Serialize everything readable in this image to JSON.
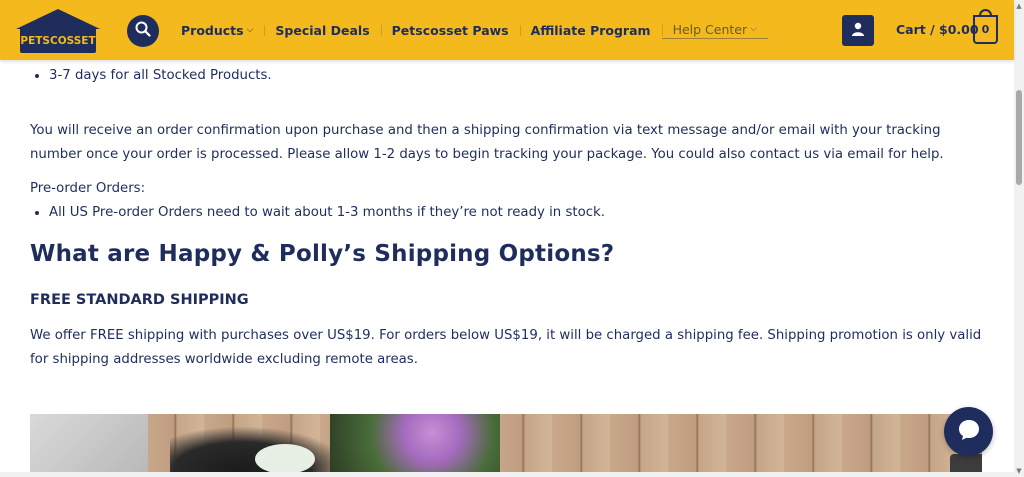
{
  "header": {
    "logo_text": "PETSCOSSET",
    "nav": [
      {
        "label": "Products",
        "has_dropdown": true
      },
      {
        "label": "Special Deals",
        "has_dropdown": false
      },
      {
        "label": "Petscosset Paws",
        "has_dropdown": false
      },
      {
        "label": "Affiliate Program",
        "has_dropdown": false
      },
      {
        "label": "Help Center",
        "has_dropdown": true
      }
    ],
    "cart_label": "Cart / $0.00",
    "cart_count": "0",
    "icons": {
      "search": "search-icon",
      "account": "user-icon",
      "chat": "chat-icon"
    }
  },
  "content": {
    "stocked_bullet": "3-7 days for all Stocked Products.",
    "confirmation_text": "You will receive an order confirmation upon purchase and then a shipping confirmation via text message and/or email with your tracking number once your order is processed. Please allow 1-2 days to begin tracking your package. You could also contact us via email for help.",
    "preorder_heading": "Pre-order Orders:",
    "preorder_bullet": "All US Pre-order Orders need to wait about 1-3 months if they’re not ready in stock.",
    "shipping_title": "What are Happy & Polly’s Shipping Options?",
    "free_shipping_heading": "FREE STANDARD SHIPPING",
    "free_shipping_text": "We offer FREE shipping with purchases over US$19. For orders below US$19, it will be charged a shipping fee. Shipping promotion is only valid for shipping addresses worldwide excluding remote areas."
  },
  "colors": {
    "header_bg": "#f4b91c",
    "brand_navy": "#1f2d5c"
  }
}
